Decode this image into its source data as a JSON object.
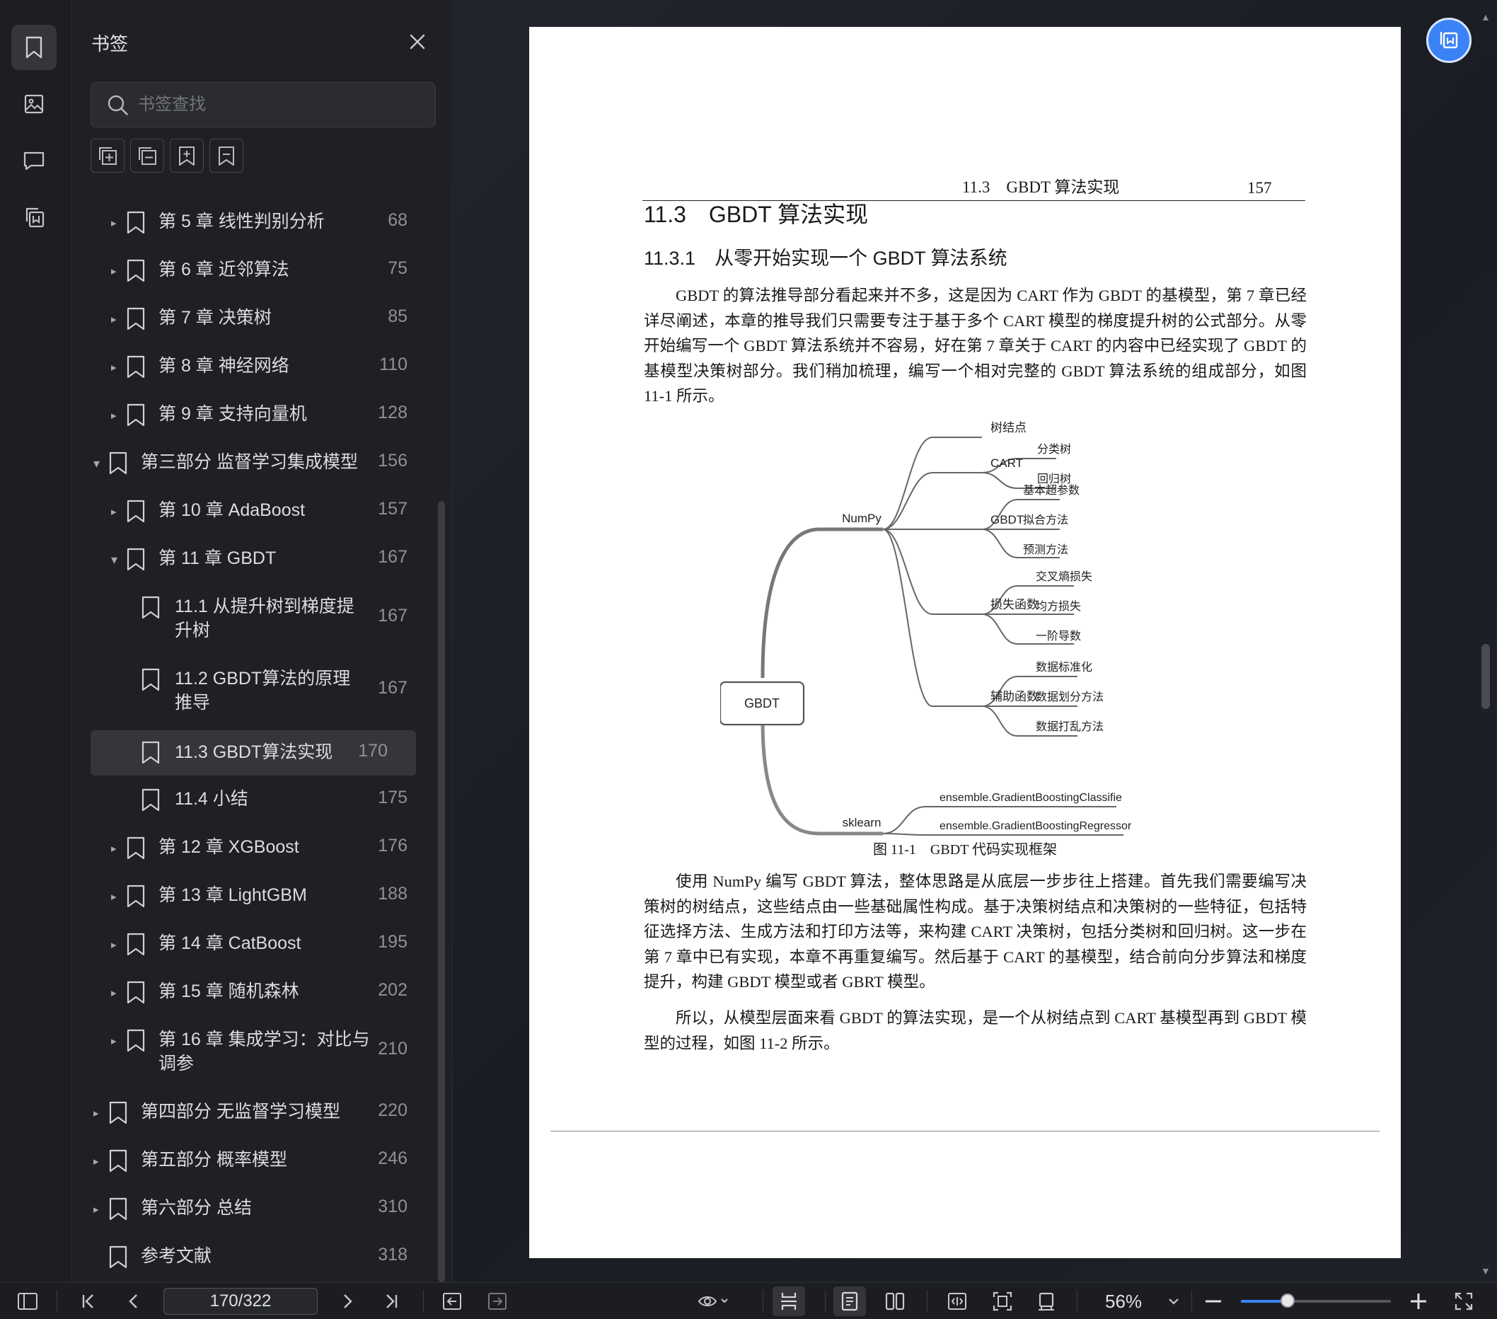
{
  "sidebar": {
    "title": "书签",
    "search_placeholder": "书签查找",
    "rail_icons": [
      "bookmark-icon",
      "image-icon",
      "comment-icon",
      "extract-icon"
    ],
    "tools": [
      "expand-all-icon",
      "collapse-all-icon",
      "add-bookmark-icon",
      "bookmark-outline-icon"
    ],
    "items": [
      {
        "label": "第 5 章 线性判别分析",
        "page": "68",
        "level": 1,
        "caret": "▸"
      },
      {
        "label": "第 6 章 近邻算法",
        "page": "75",
        "level": 1,
        "caret": "▸"
      },
      {
        "label": "第 7 章 决策树",
        "page": "85",
        "level": 1,
        "caret": "▸"
      },
      {
        "label": "第 8 章 神经网络",
        "page": "110",
        "level": 1,
        "caret": "▸"
      },
      {
        "label": "第 9 章 支持向量机",
        "page": "128",
        "level": 1,
        "caret": "▸"
      },
      {
        "label": "第三部分 监督学习集成模型",
        "page": "156",
        "level": 0,
        "caret": "▾"
      },
      {
        "label": "第 10 章 AdaBoost",
        "page": "157",
        "level": 1,
        "caret": "▸"
      },
      {
        "label": "第 11 章 GBDT",
        "page": "167",
        "level": 1,
        "caret": "▾"
      },
      {
        "label": "11.1 从提升树到梯度提升树",
        "page": "167",
        "level": 2,
        "caret": ""
      },
      {
        "label": "11.2 GBDT算法的原理推导",
        "page": "167",
        "level": 2,
        "caret": ""
      },
      {
        "label": "11.3 GBDT算法实现",
        "page": "170",
        "level": 2,
        "caret": "",
        "selected": true
      },
      {
        "label": "11.4 小结",
        "page": "175",
        "level": 2,
        "caret": ""
      },
      {
        "label": "第 12 章 XGBoost",
        "page": "176",
        "level": 1,
        "caret": "▸"
      },
      {
        "label": "第 13 章 LightGBM",
        "page": "188",
        "level": 1,
        "caret": "▸"
      },
      {
        "label": "第 14 章 CatBoost",
        "page": "195",
        "level": 1,
        "caret": "▸"
      },
      {
        "label": "第 15 章 随机森林",
        "page": "202",
        "level": 1,
        "caret": "▸"
      },
      {
        "label": "第 16 章 集成学习：对比与调参",
        "page": "210",
        "level": 1,
        "caret": "▸"
      },
      {
        "label": "第四部分 无监督学习模型",
        "page": "220",
        "level": 0,
        "caret": "▸"
      },
      {
        "label": "第五部分 概率模型",
        "page": "246",
        "level": 0,
        "caret": "▸"
      },
      {
        "label": "第六部分 总结",
        "page": "310",
        "level": 0,
        "caret": "▸"
      },
      {
        "label": "参考文献",
        "page": "318",
        "level": 0,
        "caret": ""
      }
    ]
  },
  "document": {
    "running_section": "11.3　GBDT 算法实现",
    "running_page": "157",
    "heading": "11.3　GBDT 算法实现",
    "subheading": "11.3.1　从零开始实现一个 GBDT 算法系统",
    "para1": "GBDT 的算法推导部分看起来并不多，这是因为 CART 作为 GBDT 的基模型，第 7 章已经详尽阐述，本章的推导我们只需要专注于基于多个 CART 模型的梯度提升树的公式部分。从零开始编写一个 GBDT 算法系统并不容易，好在第 7 章关于 CART 的内容中已经实现了 GBDT 的基模型决策树部分。我们稍加梳理，编写一个相对完整的 GBDT 算法系统的组成部分，如图 11-1 所示。",
    "figure": {
      "root": "GBDT",
      "numpy": "NumPy",
      "sklearn": "sklearn",
      "tree_node": "树结点",
      "cart": "CART",
      "cart_children": [
        "分类树",
        "回归树"
      ],
      "gbdt": "GBDT",
      "gbdt_children": [
        "基本超参数",
        "拟合方法",
        "预测方法"
      ],
      "loss": "损失函数",
      "loss_children": [
        "交叉熵损失",
        "均方损失",
        "一阶导数"
      ],
      "helper": "辅助函数",
      "helper_children": [
        "数据标准化",
        "数据划分方法",
        "数据打乱方法"
      ],
      "sklearn_children": [
        "ensemble.GradientBoostingClassifie",
        "ensemble.GradientBoostingRegressor"
      ]
    },
    "caption": "图 11-1　GBDT 代码实现框架",
    "para2": "使用 NumPy 编写 GBDT 算法，整体思路是从底层一步步往上搭建。首先我们需要编写决策树的树结点，这些结点由一些基础属性构成。基于决策树结点和决策树的一些特征，包括特征选择方法、生成方法和打印方法等，来构建 CART 决策树，包括分类树和回归树。这一步在第 7 章中已有实现，本章不再重复编写。然后基于 CART 的基模型，结合前向分步算法和梯度提升，构建 GBDT 模型或者 GBRT 模型。",
    "para3": "所以，从模型层面来看 GBDT 的算法实现，是一个从树结点到 CART 基模型再到 GBDT 模型的过程，如图 11-2 所示。"
  },
  "toolbar": {
    "page_indicator": "170/322",
    "zoom": "56%",
    "zoom_fraction": 0.31,
    "accent": "#3b82f6"
  }
}
